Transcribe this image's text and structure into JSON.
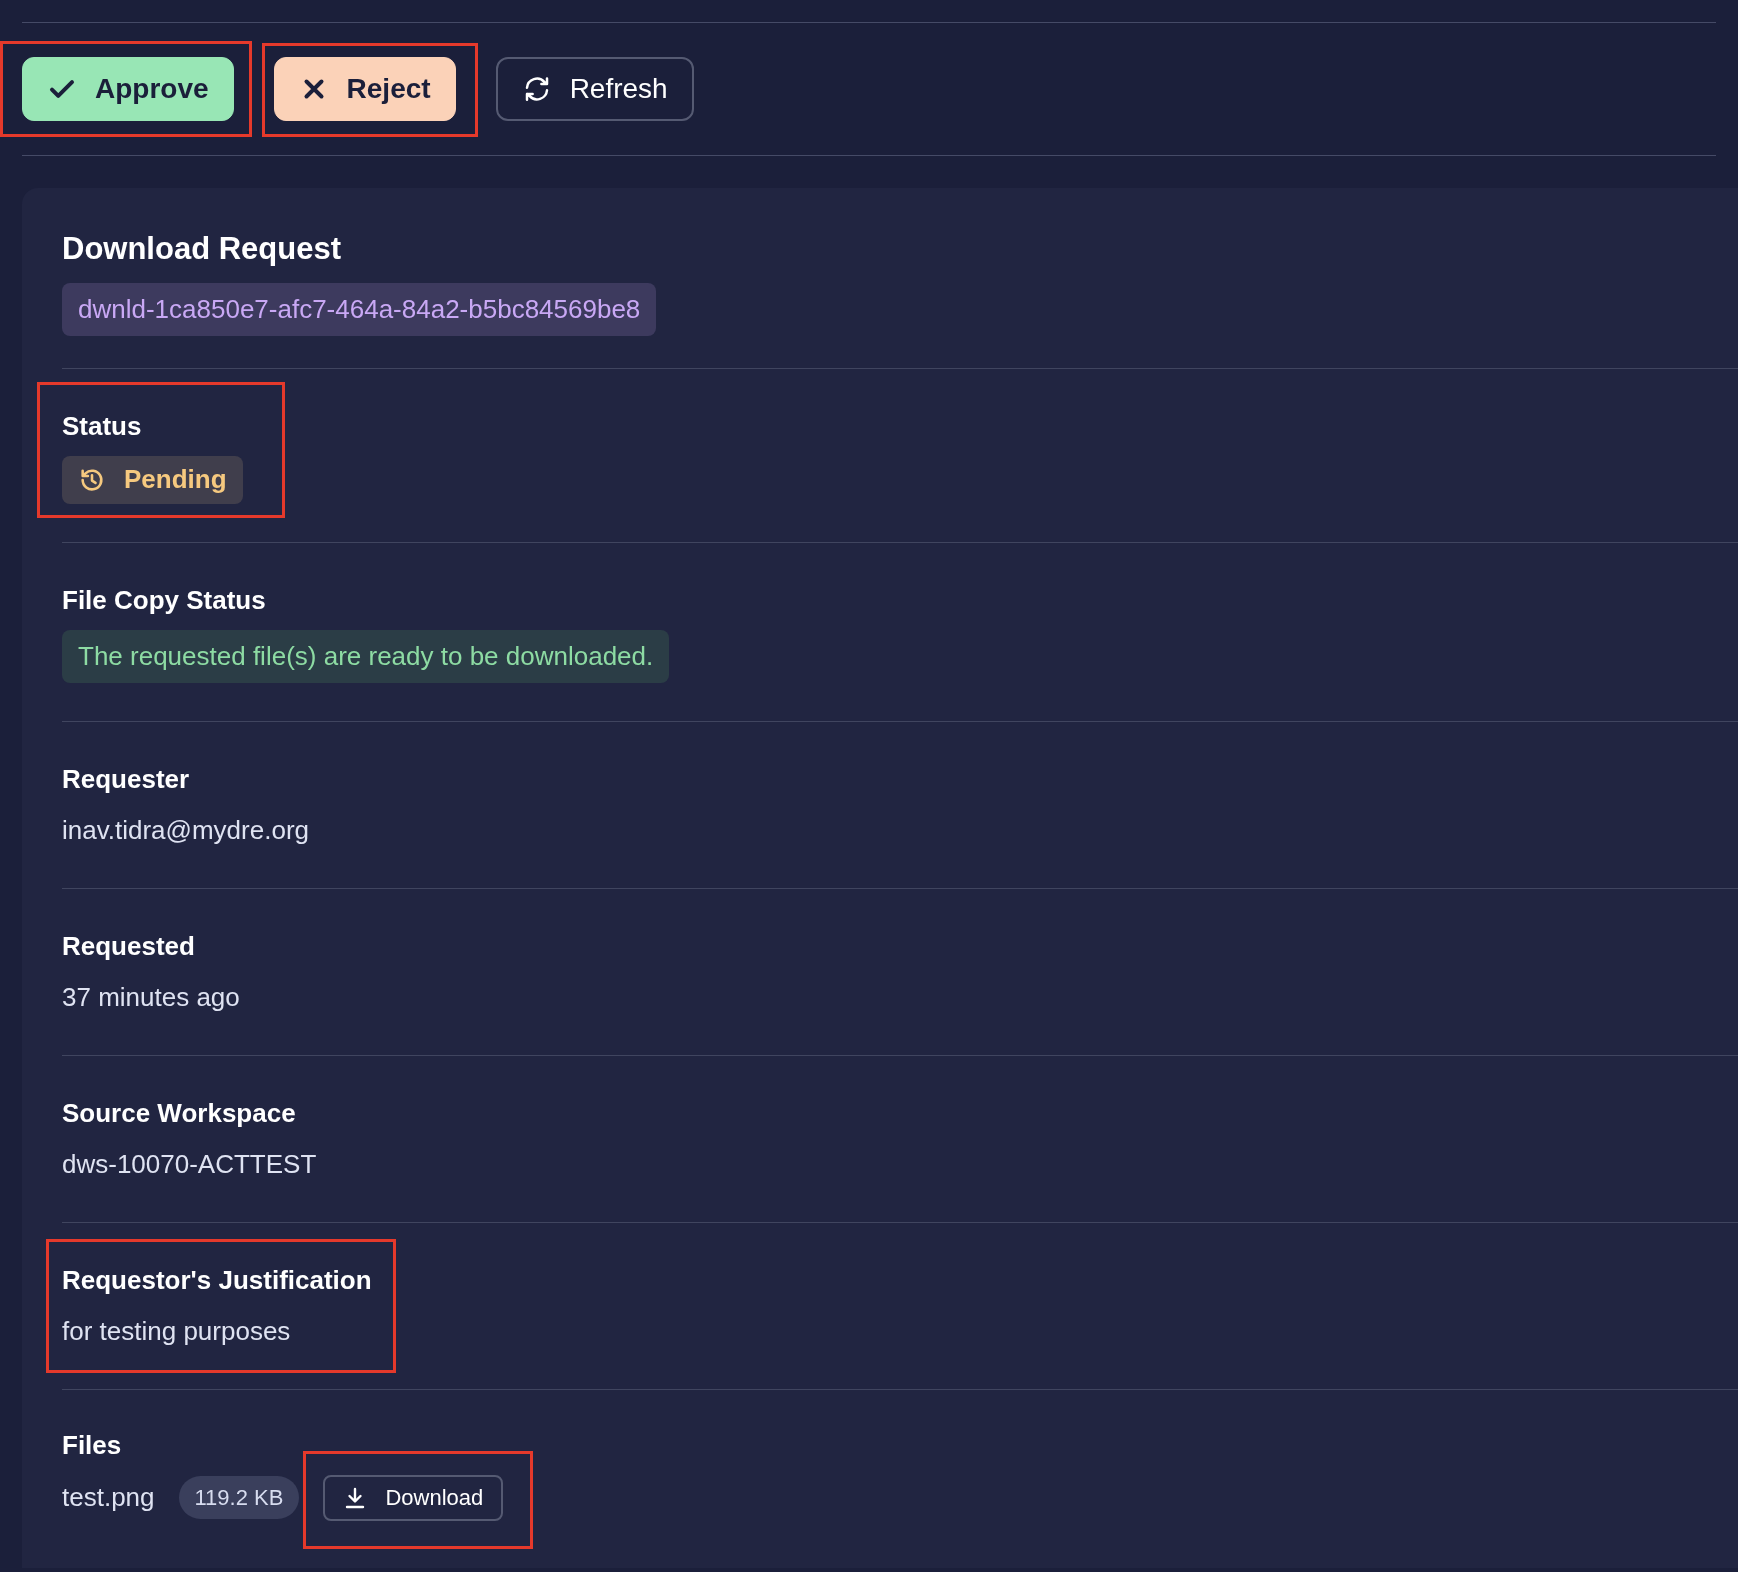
{
  "actions": [
    {
      "kind": "approve",
      "label": "Approve",
      "highlighted": true
    },
    {
      "kind": "reject",
      "label": "Reject",
      "highlighted": true
    },
    {
      "kind": "refresh",
      "label": "Refresh",
      "highlighted": false
    }
  ],
  "request": {
    "title": "Download Request",
    "id": "dwnld-1ca850e7-afc7-464a-84a2-b5bc84569be8"
  },
  "sections": [
    {
      "kind": "status",
      "label": "Status",
      "value": "Pending",
      "highlighted": true
    },
    {
      "kind": "note",
      "label": "File Copy Status",
      "value": "The requested file(s) are ready to be downloaded.",
      "highlighted": false
    },
    {
      "kind": "text",
      "label": "Requester",
      "value": "inav.tidra@mydre.org",
      "highlighted": false
    },
    {
      "kind": "text",
      "label": "Requested",
      "value": "37 minutes ago",
      "highlighted": false
    },
    {
      "kind": "text",
      "label": "Source Workspace",
      "value": "dws-10070-ACTTEST",
      "highlighted": false
    },
    {
      "kind": "text",
      "label": "Requestor's Justification",
      "value": "for testing purposes",
      "highlighted": true
    },
    {
      "kind": "files",
      "label": "Files",
      "files": [
        {
          "name": "test.png",
          "size": "119.2 KB",
          "action": "Download",
          "highlighted": true
        }
      ]
    }
  ]
}
